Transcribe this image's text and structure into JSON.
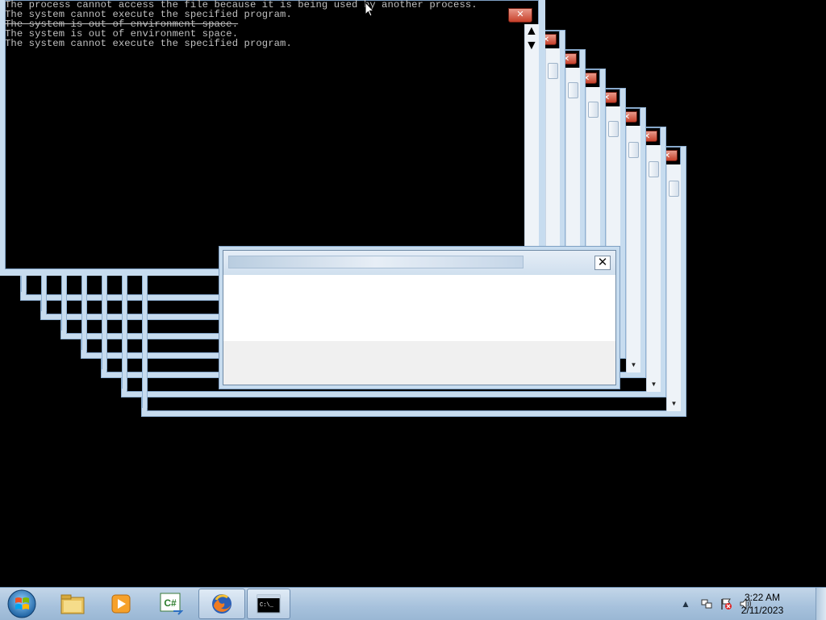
{
  "console": {
    "lines": [
      "The process cannot access the file because it is being used by another process.",
      "The system cannot execute the specified program.",
      "The system is out of environment space.",
      "The system is out of environment space.",
      "The system cannot execute the specified program."
    ]
  },
  "dialog": {
    "close_glyph": "✕"
  },
  "taskbar": {
    "start_icon": "windows-start-orb",
    "pinned": [
      {
        "name": "file-explorer-icon"
      },
      {
        "name": "media-player-icon"
      },
      {
        "name": "csharp-icon",
        "label": "C#"
      },
      {
        "name": "firefox-icon"
      },
      {
        "name": "command-prompt-icon",
        "label": "C:\\_"
      }
    ],
    "tray": {
      "time": "3:22 AM",
      "date": "2/11/2023"
    }
  },
  "colors": {
    "frame": "#c7dcef",
    "close_red": "#c7402a",
    "taskbar": "#a6c1dc"
  }
}
